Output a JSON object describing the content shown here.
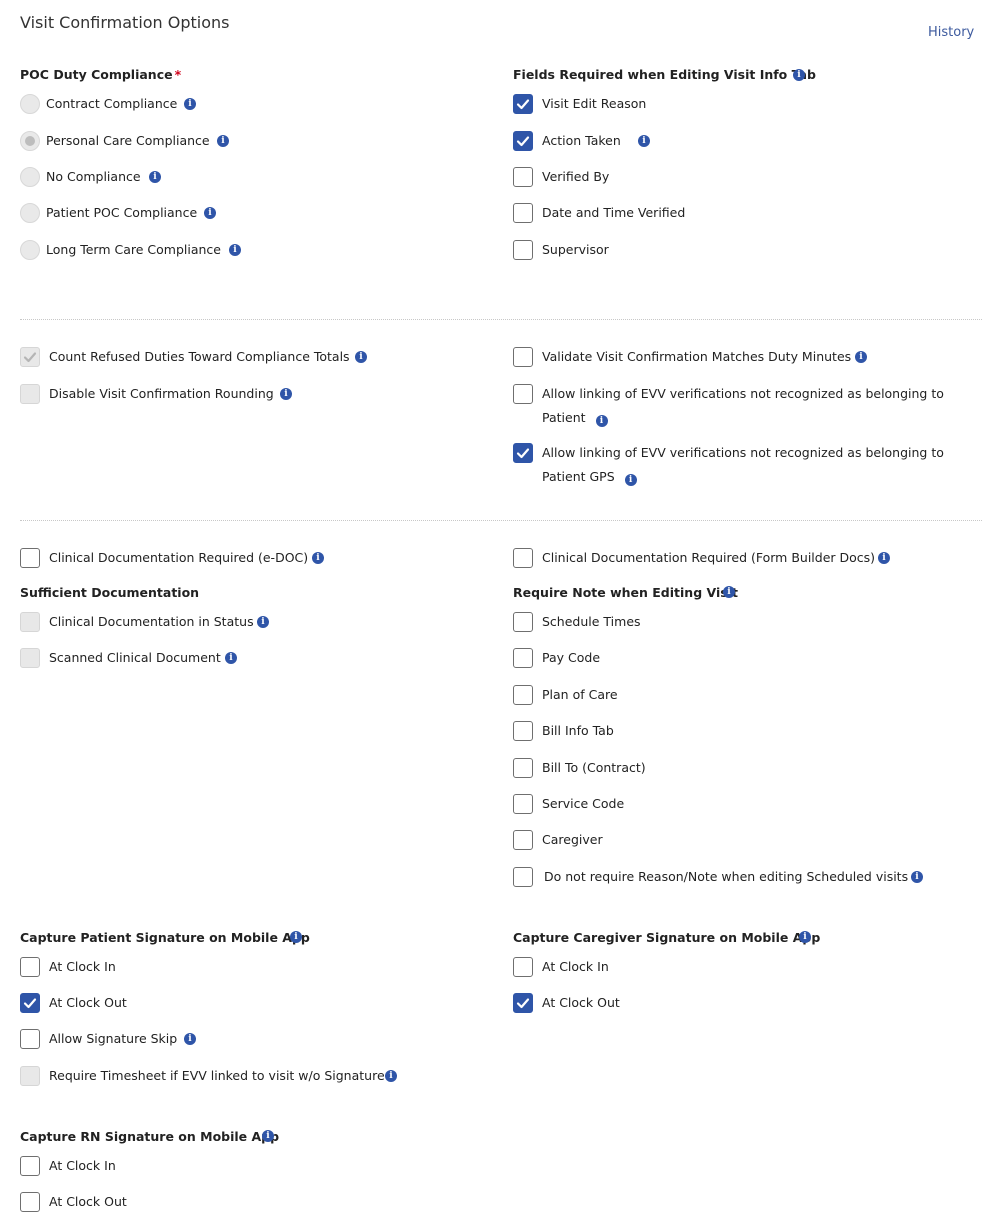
{
  "header": {
    "title": "Visit Confirmation Options",
    "history_link": "History"
  },
  "poc": {
    "title": "POC Duty Compliance",
    "required_mark": "*",
    "options": [
      {
        "label": "Contract Compliance",
        "selected": false
      },
      {
        "label": "Personal Care Compliance",
        "selected": true
      },
      {
        "label": "No Compliance",
        "selected": false
      },
      {
        "label": "Patient POC Compliance",
        "selected": false
      },
      {
        "label": "Long Term Care Compliance",
        "selected": false
      }
    ]
  },
  "fields_required": {
    "title": "Fields Required when Editing Visit Info Tab",
    "items": [
      {
        "label": "Visit Edit Reason",
        "checked": true
      },
      {
        "label": "Action Taken",
        "checked": true
      },
      {
        "label": "Verified By",
        "checked": false
      },
      {
        "label": "Date and Time Verified",
        "checked": false
      },
      {
        "label": "Supervisor",
        "checked": false
      }
    ]
  },
  "general": {
    "count_refused": {
      "label": "Count Refused Duties Toward Compliance Totals",
      "checked": true,
      "disabled": true
    },
    "disable_rounding": {
      "label": "Disable Visit Confirmation Rounding",
      "checked": false,
      "disabled": true
    },
    "validate_minutes": {
      "label": "Validate Visit Confirmation Matches Duty Minutes",
      "checked": false
    },
    "allow_linking_patient": {
      "label": "Allow linking of EVV verifications not recognized as belonging to Patient",
      "checked": false
    },
    "allow_linking_gps": {
      "label": "Allow linking of EVV verifications not recognized as belonging to Patient GPS",
      "checked": true
    }
  },
  "clinical": {
    "edoc": {
      "label": "Clinical Documentation Required (e-DOC)",
      "checked": false
    },
    "form_builder": {
      "label": "Clinical Documentation Required (Form Builder Docs)",
      "checked": false
    },
    "sufficient_title": "Sufficient Documentation",
    "sufficient_items": [
      {
        "label": "Clinical Documentation in Status",
        "checked": false,
        "disabled": true
      },
      {
        "label": "Scanned Clinical Document",
        "checked": false,
        "disabled": true
      }
    ]
  },
  "require_note": {
    "title": "Require Note when Editing Visit",
    "items": [
      {
        "label": "Schedule Times",
        "checked": false
      },
      {
        "label": "Pay Code",
        "checked": false
      },
      {
        "label": "Plan of Care",
        "checked": false
      },
      {
        "label": "Bill Info Tab",
        "checked": false
      },
      {
        "label": "Bill To (Contract)",
        "checked": false
      },
      {
        "label": "Service Code",
        "checked": false
      },
      {
        "label": "Caregiver",
        "checked": false
      },
      {
        "label": "Do not require Reason/Note when editing Scheduled visits",
        "checked": false
      }
    ]
  },
  "patient_signature": {
    "title": "Capture Patient Signature on Mobile App",
    "items": [
      {
        "label": "At Clock In",
        "checked": false
      },
      {
        "label": "At Clock Out",
        "checked": true
      },
      {
        "label": "Allow Signature Skip",
        "checked": false
      },
      {
        "label": "Require Timesheet if EVV linked to visit w/o Signature",
        "checked": false,
        "disabled": true
      }
    ]
  },
  "caregiver_signature": {
    "title": "Capture Caregiver Signature on Mobile App",
    "items": [
      {
        "label": "At Clock In",
        "checked": false
      },
      {
        "label": "At Clock Out",
        "checked": true
      }
    ]
  },
  "rn_signature": {
    "title": "Capture RN Signature on Mobile App",
    "items": [
      {
        "label": "At Clock In",
        "checked": false
      },
      {
        "label": "At Clock Out",
        "checked": false
      }
    ]
  },
  "icons": {
    "info": "info-icon",
    "check": "check-icon"
  },
  "colors": {
    "accent": "#2f55a8",
    "link": "#3d5a9e",
    "required": "#d0021b"
  }
}
